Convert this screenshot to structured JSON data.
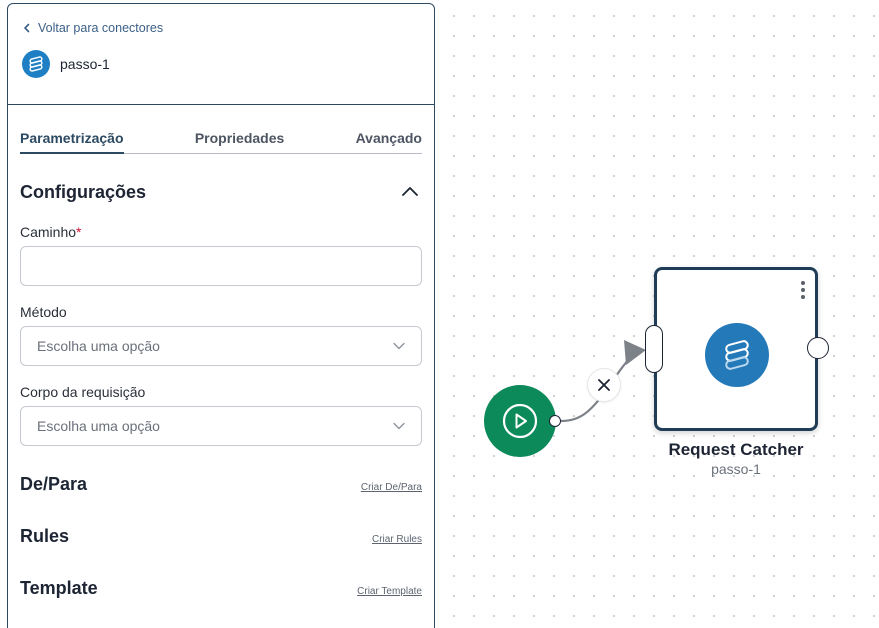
{
  "panel": {
    "back_label": "Voltar para conectores",
    "step_name": "passo-1",
    "tabs": [
      {
        "label": "Parametrização",
        "active": true
      },
      {
        "label": "Propriedades",
        "active": false
      },
      {
        "label": "Avançado",
        "active": false
      }
    ],
    "config_title": "Configurações",
    "fields": {
      "path_label": "Caminho",
      "path_required_mark": "*",
      "path_value": "",
      "method_label": "Método",
      "method_placeholder": "Escolha uma opção",
      "body_label": "Corpo da requisição",
      "body_placeholder": "Escolha uma opção"
    },
    "sections": [
      {
        "title": "De/Para",
        "link": "Criar De/Para"
      },
      {
        "title": "Rules",
        "link": "Criar Rules"
      },
      {
        "title": "Template",
        "link": "Criar Template"
      }
    ]
  },
  "canvas": {
    "node": {
      "title": "Request Catcher",
      "subtitle": "passo-1"
    },
    "icons": {
      "start": "play-icon",
      "delete_edge": "close-icon",
      "node_menu": "kebab-menu-icon",
      "connector": "request-catcher-icon"
    }
  },
  "colors": {
    "accent": "#2d4a63",
    "start_node": "#0d8a5a",
    "connector_icon": "#2479b8",
    "required": "#c8102e"
  }
}
